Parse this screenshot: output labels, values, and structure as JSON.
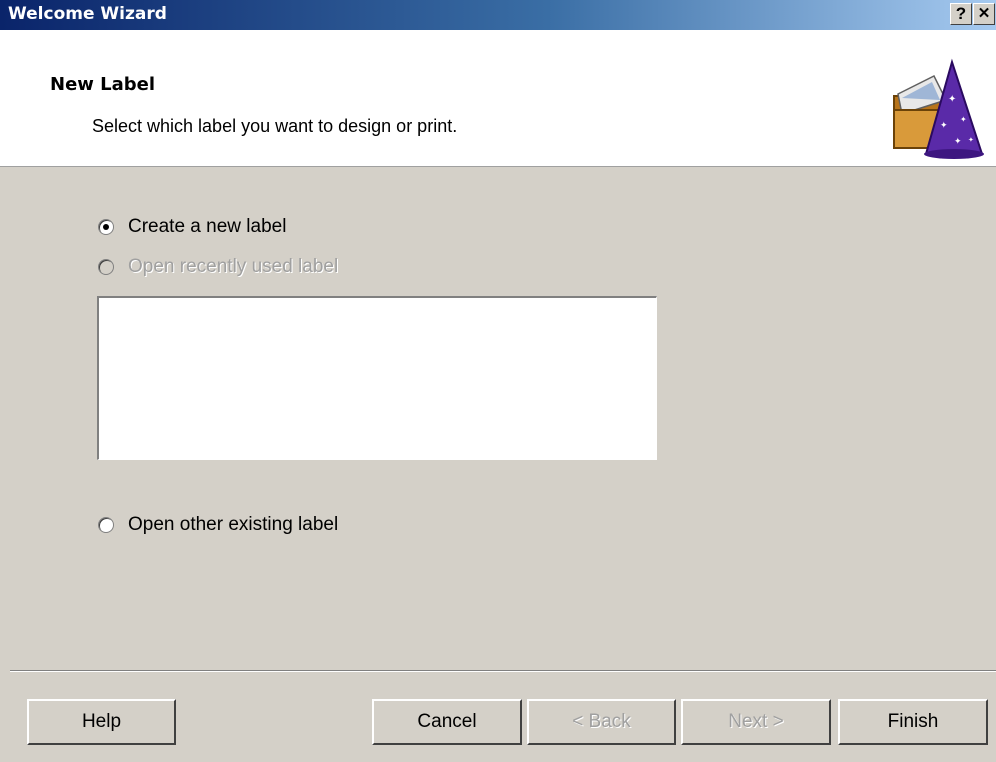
{
  "window": {
    "title": "Welcome Wizard",
    "help_button_label": "?",
    "close_button_label": "✕"
  },
  "header": {
    "title": "New Label",
    "subtitle": "Select which label you want to design or print."
  },
  "options": [
    {
      "label": "Create a new label",
      "selected": true,
      "enabled": true
    },
    {
      "label": "Open recently used label",
      "selected": false,
      "enabled": false
    },
    {
      "label": "Open other existing label",
      "selected": false,
      "enabled": true
    }
  ],
  "recent_labels": [],
  "buttons": {
    "help": "Help",
    "cancel": "Cancel",
    "back": "< Back",
    "next": "Next >",
    "finish": "Finish"
  },
  "icons": {
    "wizard": "wizard-hat-folder-icon"
  }
}
